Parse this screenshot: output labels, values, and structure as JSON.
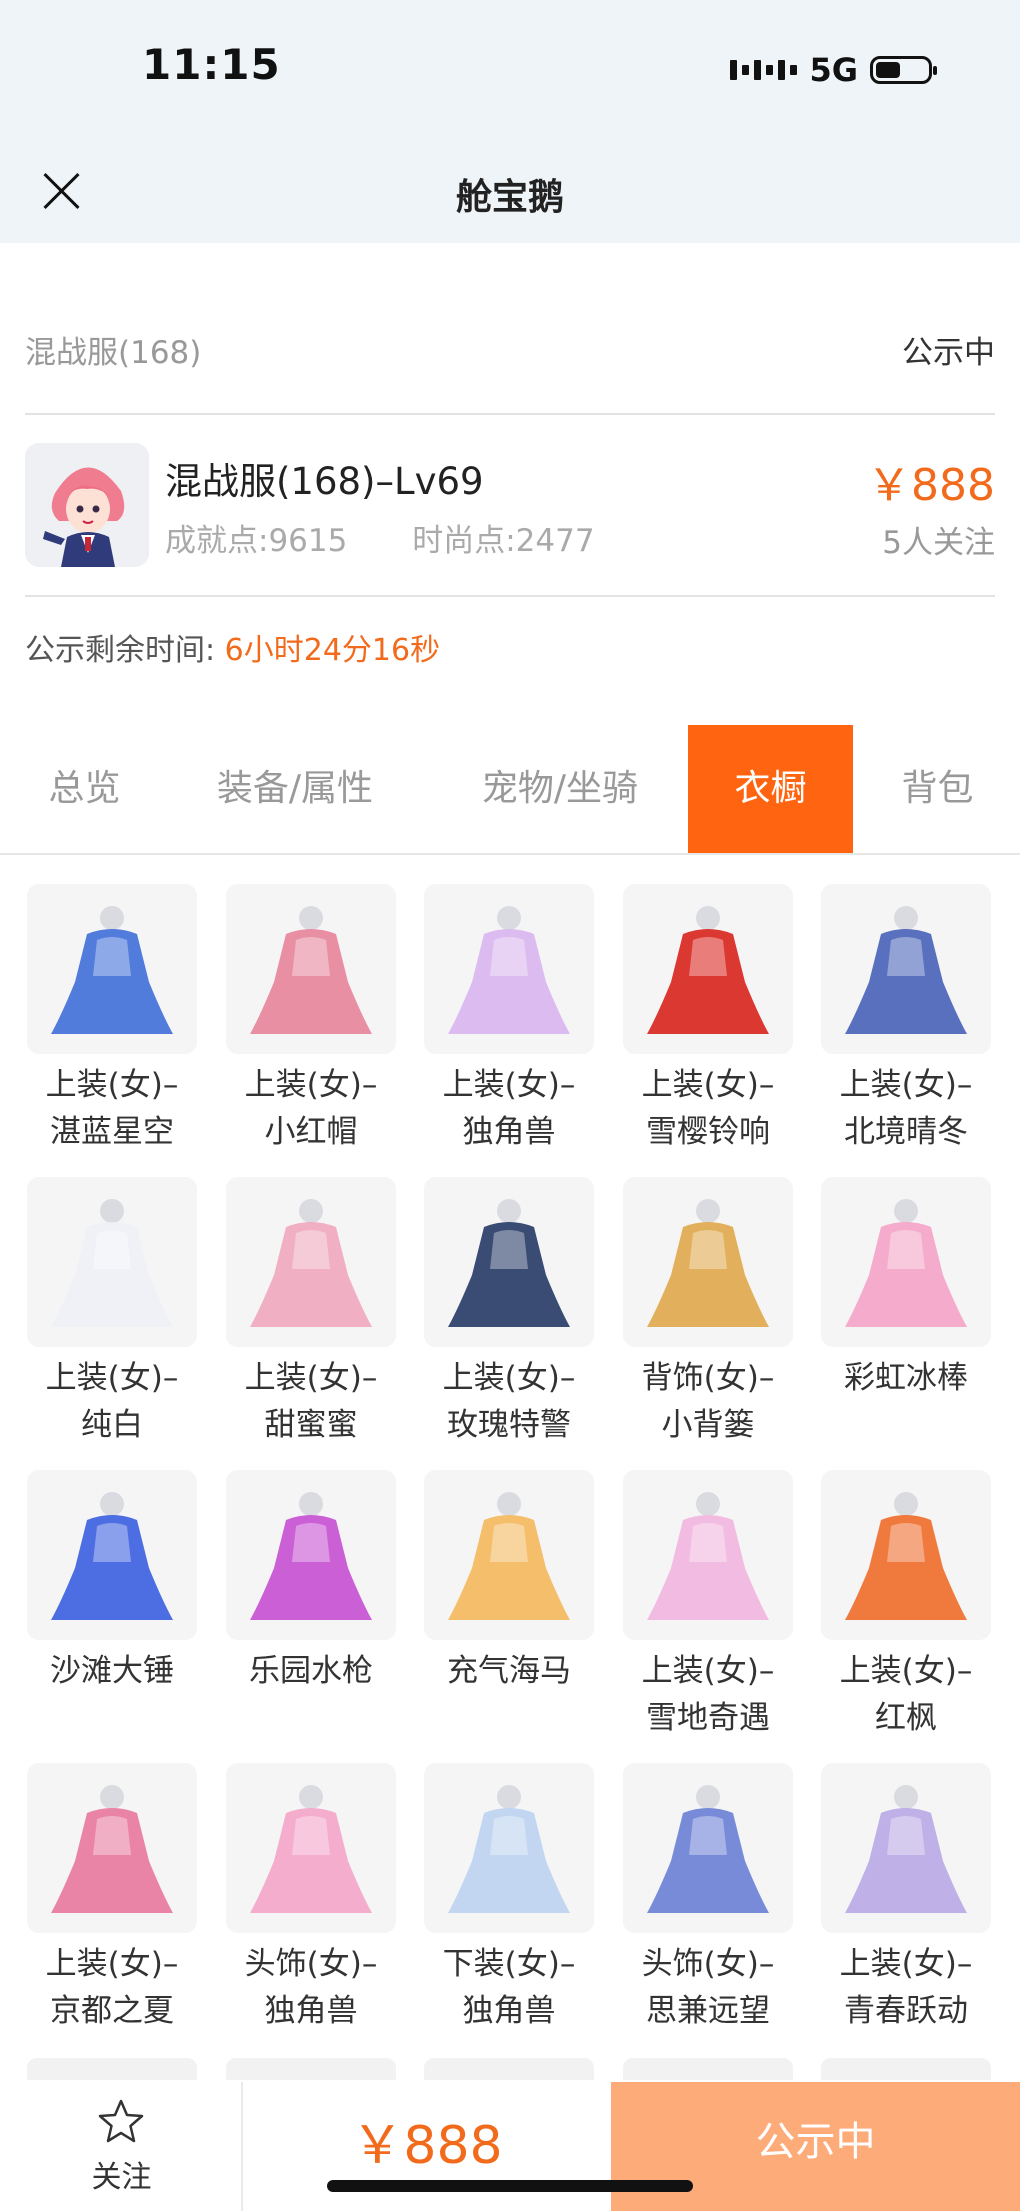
{
  "status_bar": {
    "time": "11:15",
    "network": "5G"
  },
  "nav": {
    "title": "舱宝鹅"
  },
  "listing": {
    "server": "混战服(168)",
    "status": "公示中",
    "character_name": "混战服(168)–Lv69",
    "achievement_label": "成就点:9615",
    "fashion_label": "时尚点:2477",
    "price": "￥888",
    "followers": "5人关注",
    "remaining_label": "公示剩余时间:",
    "remaining_time": "6小时24分16秒"
  },
  "tabs": [
    {
      "label": "总览",
      "active": false
    },
    {
      "label": "装备/属性",
      "active": false
    },
    {
      "label": "宠物/坐骑",
      "active": false
    },
    {
      "label": "衣橱",
      "active": true
    },
    {
      "label": "背包",
      "active": false
    }
  ],
  "wardrobe": [
    {
      "line1": "上装(女)–",
      "line2": "湛蓝星空",
      "icon": "blue-starry-dress-icon",
      "color": "#3f6fd8"
    },
    {
      "line1": "上装(女)–",
      "line2": "小红帽",
      "icon": "little-red-hood-dress-icon",
      "color": "#e8849a"
    },
    {
      "line1": "上装(女)–",
      "line2": "独角兽",
      "icon": "unicorn-winged-outfit-icon",
      "color": "#d9b6f0"
    },
    {
      "line1": "上装(女)–",
      "line2": "雪樱铃响",
      "icon": "snow-sakura-bell-outfit-icon",
      "color": "#d9231d"
    },
    {
      "line1": "上装(女)–",
      "line2": "北境晴冬",
      "icon": "north-winter-outfit-icon",
      "color": "#4862b8"
    },
    {
      "line1": "上装(女)–",
      "line2": "纯白",
      "icon": "pure-white-dress-icon",
      "color": "#eef1f7"
    },
    {
      "line1": "上装(女)–",
      "line2": "甜蜜蜜",
      "icon": "sweet-pink-dress-icon",
      "color": "#f0a7bd"
    },
    {
      "line1": "上装(女)–",
      "line2": "玫瑰特警",
      "icon": "rose-police-uniform-icon",
      "color": "#263a66"
    },
    {
      "line1": "背饰(女)–",
      "line2": "小背篓",
      "icon": "flower-basket-icon",
      "color": "#e0a94c"
    },
    {
      "line1": "彩虹冰棒",
      "line2": "",
      "icon": "rainbow-popsicle-icon",
      "color": "#f5a3c7"
    },
    {
      "line1": "沙滩大锤",
      "line2": "",
      "icon": "beach-hammer-icon",
      "color": "#3b5ee0"
    },
    {
      "line1": "乐园水枪",
      "line2": "",
      "icon": "water-gun-icon",
      "color": "#c64fd3"
    },
    {
      "line1": "充气海马",
      "line2": "",
      "icon": "inflatable-seahorse-bow-icon",
      "color": "#f4b85c"
    },
    {
      "line1": "上装(女)–",
      "line2": "雪地奇遇",
      "icon": "snow-adventure-dress-icon",
      "color": "#f2b5df"
    },
    {
      "line1": "上装(女)–",
      "line2": "红枫",
      "icon": "red-maple-outfit-icon",
      "color": "#f06b2a"
    },
    {
      "line1": "上装(女)–",
      "line2": "京都之夏",
      "icon": "kyoto-summer-kimono-icon",
      "color": "#e9789f"
    },
    {
      "line1": "头饰(女)–",
      "line2": "独角兽",
      "icon": "unicorn-hood-icon",
      "color": "#f4a5c8"
    },
    {
      "line1": "下装(女)–",
      "line2": "独角兽",
      "icon": "unicorn-pants-icon",
      "color": "#bcd3f2"
    },
    {
      "line1": "头饰(女)–",
      "line2": "思兼远望",
      "icon": "space-helmet-icon",
      "color": "#6a7fd6"
    },
    {
      "line1": "上装(女)–",
      "line2": "青春跃动",
      "icon": "youth-sport-top-icon",
      "color": "#b9a8e6"
    }
  ],
  "bottom_bar": {
    "follow_label": "关注",
    "price": "￥888",
    "action_label": "公示中"
  }
}
